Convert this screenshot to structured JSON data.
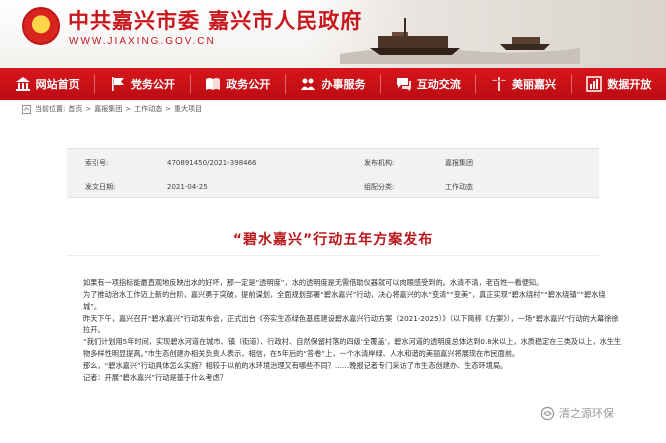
{
  "header": {
    "title": "中共嘉兴市委 嘉兴市人民政府",
    "url": "WWW.JIAXING.GOV.CN"
  },
  "nav": {
    "items": [
      {
        "label": "网站首页",
        "icon": "building-icon"
      },
      {
        "label": "党务公开",
        "icon": "party-flag-icon"
      },
      {
        "label": "政务公开",
        "icon": "government-book-icon"
      },
      {
        "label": "办事服务",
        "icon": "people-service-icon"
      },
      {
        "label": "互动交流",
        "icon": "chat-bubble-icon"
      },
      {
        "label": "美丽嘉兴",
        "icon": "palm-tree-icon"
      },
      {
        "label": "数据开放",
        "icon": "chart-icon"
      }
    ]
  },
  "breadcrumb": {
    "prefix": "当前位置:",
    "items": [
      "首页",
      "嘉报集团",
      "工作动态",
      "重大项目"
    ],
    "sep": ">"
  },
  "meta": {
    "index_label": "索引号:",
    "index_value": "470891450/2021-398466",
    "org_label": "发布机构:",
    "org_value": "嘉报集团",
    "date_label": "发文日期:",
    "date_value": "2021-04-25",
    "category_label": "组配分类:",
    "category_value": "工作动态"
  },
  "article": {
    "title": "“碧水嘉兴”行动五年方案发布",
    "paragraphs": [
      "如果有一项指标能最直观地反映出水的好坏，那一定是“透明度”，水的透明度是无需借助仪器就可以肉眼感受到的。水清不清，老百姓一看便知。",
      "为了推动治水工作迈上新的台阶，嘉兴勇于突破，提前谋划，全面规划部署“碧水嘉兴”行动，决心将嘉兴的水“变清”“变美”，真正实现“碧水绕村”“碧水绕镇”“碧水绕城”。",
      "昨天下午，嘉兴召开“碧水嘉兴”行动发布会，正式出台《夯实生态绿色基底建设碧水嘉兴行动方案（2021-2025）》（以下简称《方案》），一场“碧水嘉兴”行动的大幕徐徐拉开。",
      "“我们计划用5年时间，实现碧水河道在城市、镇（街道）、行政村、自然保留村落的四级‘全覆盖’，碧水河道的透明度总体达到0.8米以上，水质稳定在三类及以上，水生生物多样性明显提高。”市生态创建办相关负责人表示，相信，在5年后的“答卷”上，一个水清岸绿、人水和谐的美丽嘉兴将展现在市民面前。",
      "那么，“碧水嘉兴”行动具体怎么实施？相较于以前的水环境治理又有哪些不同？……晚报记者专门采访了市生态创建办、生态环境局。",
      "记者：开展“碧水嘉兴”行动是基于什么考虑？"
    ]
  },
  "watermark": {
    "text": "清之源环保"
  },
  "colors": {
    "brand_red": "#c8161d",
    "nav_red": "#c81016",
    "meta_bg": "#f2f2f2"
  }
}
